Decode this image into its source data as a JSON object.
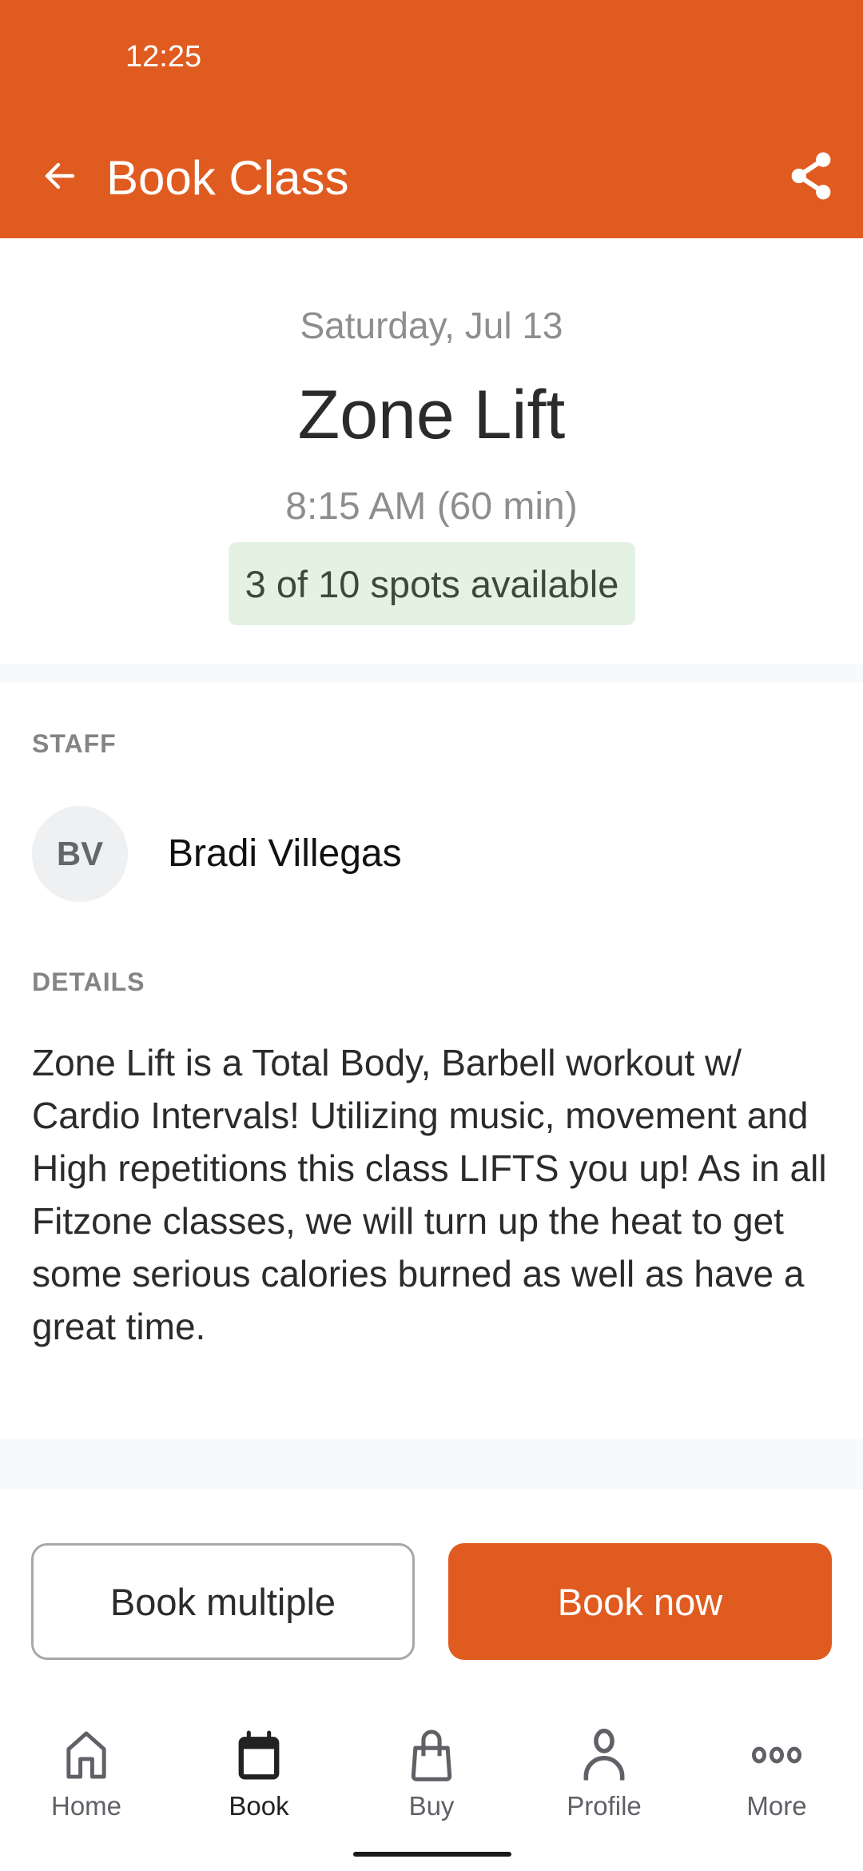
{
  "status_bar": {
    "time": "12:25"
  },
  "app_bar": {
    "title": "Book Class",
    "back_icon": "arrow-left-icon",
    "share_icon": "share-icon"
  },
  "class": {
    "date": "Saturday, Jul 13",
    "name": "Zone Lift",
    "time": "8:15 AM (60 min)",
    "availability": "3 of 10 spots available"
  },
  "staff": {
    "section_label": "STAFF",
    "initials": "BV",
    "name": "Bradi Villegas"
  },
  "details": {
    "section_label": "DETAILS",
    "text": "Zone Lift is a Total Body, Barbell workout w/ Cardio Intervals! Utilizing music, movement and High repetitions this class LIFTS you up! As in all Fitzone classes, we will turn up the heat to get some serious calories burned as well as have a great time."
  },
  "actions": {
    "book_multiple": "Book multiple",
    "book_now": "Book now"
  },
  "bottom_nav": {
    "items": [
      {
        "label": "Home",
        "icon": "home-icon",
        "active": false
      },
      {
        "label": "Book",
        "icon": "calendar-icon",
        "active": true
      },
      {
        "label": "Buy",
        "icon": "shopping-bag-icon",
        "active": false
      },
      {
        "label": "Profile",
        "icon": "person-icon",
        "active": false
      },
      {
        "label": "More",
        "icon": "more-dots-icon",
        "active": false
      }
    ]
  },
  "colors": {
    "brand": "#E05B20",
    "badge_bg": "#E4F2E3",
    "badge_text": "#3C4A3D"
  }
}
